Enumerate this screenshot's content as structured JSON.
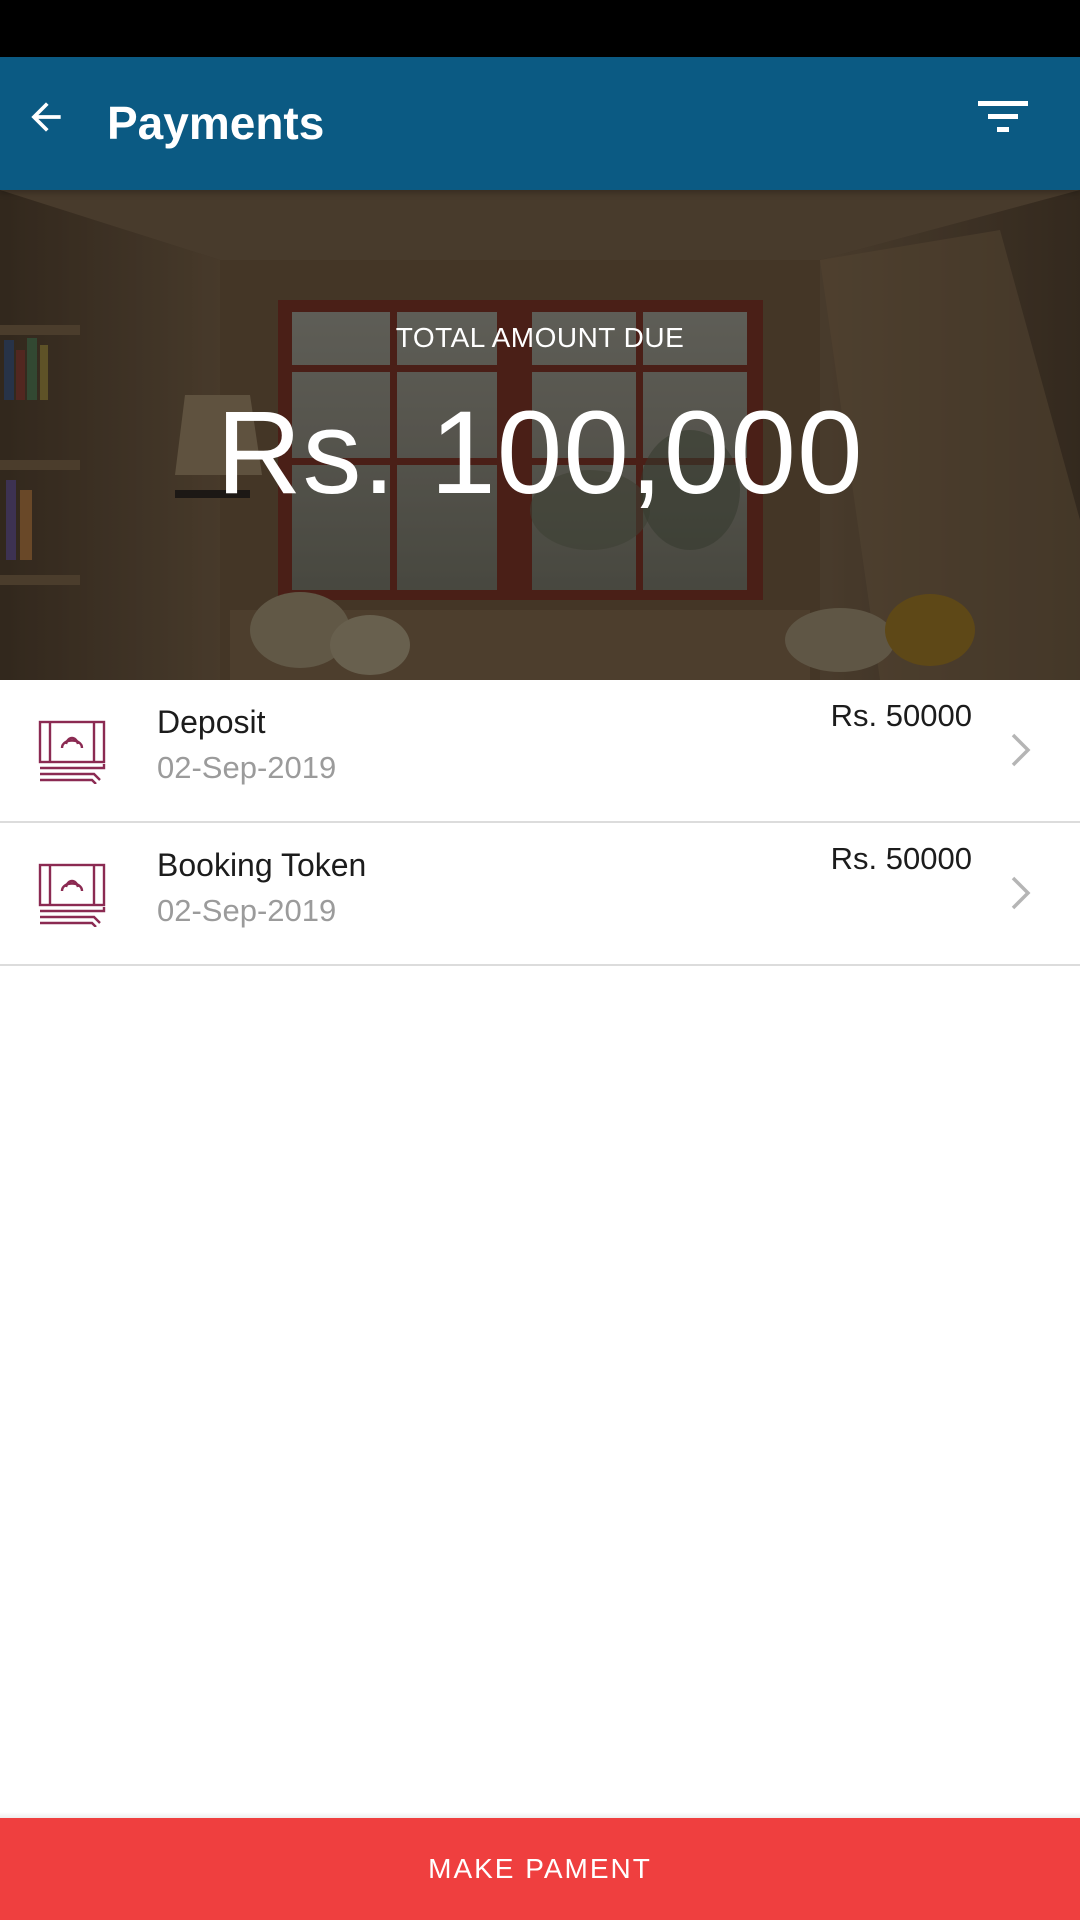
{
  "app_bar": {
    "title": "Payments",
    "back_icon": "arrow-left-icon",
    "filter_icon": "filter-icon",
    "color": "#0b5a83"
  },
  "hero": {
    "label": "TOTAL AMOUNT DUE",
    "amount": "Rs. 100,000"
  },
  "payments": [
    {
      "title": "Deposit",
      "date": "02-Sep-2019",
      "amount": "Rs. 50000",
      "icon": "cash-stack-icon"
    },
    {
      "title": "Booking Token",
      "date": "02-Sep-2019",
      "amount": "Rs. 50000",
      "icon": "cash-stack-icon"
    }
  ],
  "action": {
    "label": "MAKE PAMENT",
    "color": "#ef3f3f"
  },
  "colors": {
    "icon_accent": "#8b2a52",
    "secondary_text": "#9b9b9b"
  }
}
